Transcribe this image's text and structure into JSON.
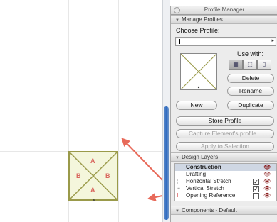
{
  "panel": {
    "title": "Profile Manager",
    "manage_section": "Manage Profiles",
    "choose_label": "Choose Profile:",
    "use_with_label": "Use with:",
    "buttons": {
      "delete": "Delete",
      "rename": "Rename",
      "new": "New",
      "duplicate": "Duplicate",
      "store": "Store Profile",
      "capture": "Capture Element's profile...",
      "apply": "Apply to Selection"
    },
    "design_layers_section": "Design Layers",
    "layers": [
      {
        "name": "Construction",
        "checked": ""
      },
      {
        "name": "Drafting",
        "checked": ""
      },
      {
        "name": "Horizontal Stretch",
        "checked": "✓"
      },
      {
        "name": "Vertical Stretch",
        "checked": "✓"
      },
      {
        "name": "Opening Reference",
        "checked": ""
      }
    ],
    "components_section": "Components - Default"
  },
  "canvas": {
    "letters": {
      "top": "A",
      "bottom": "A",
      "left": "B",
      "right": "B"
    },
    "origin_mark": "×"
  },
  "colors": {
    "shape_stroke": "#9a9a4a",
    "shape_fill": "#f4f6dc",
    "letters": "#d9665e",
    "arrows": "#e86a5a"
  }
}
